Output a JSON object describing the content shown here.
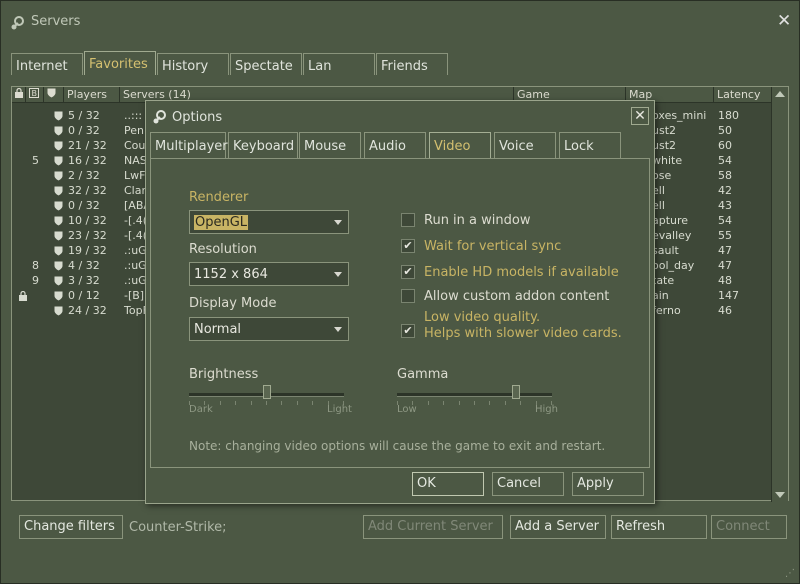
{
  "window": {
    "title": "Servers"
  },
  "tabs": [
    "Internet",
    "Favorites",
    "History",
    "Spectate",
    "Lan",
    "Friends"
  ],
  "active_tab": "Favorites",
  "columns": {
    "players": "Players",
    "servers": "Servers (14)",
    "game": "Game",
    "map": "Map",
    "latency": "Latency"
  },
  "rows": [
    {
      "num": "",
      "players": "5 / 32",
      "name": "..:::",
      "map": "oxes_mini",
      "latency": "180"
    },
    {
      "num": "",
      "players": "0 / 32",
      "name": "Pen:",
      "map": "ust2",
      "latency": "50"
    },
    {
      "num": "",
      "players": "21 / 32",
      "name": "Cou",
      "map": "ust2",
      "latency": "60"
    },
    {
      "num": "5",
      "players": "16 / 32",
      "name": "NAS",
      "map": "white",
      "latency": "54"
    },
    {
      "num": "",
      "players": "2 / 32",
      "name": "LwF",
      "map": "ose",
      "latency": "58"
    },
    {
      "num": "",
      "players": "32 / 32",
      "name": "Clan",
      "map": "ell",
      "latency": "42"
    },
    {
      "num": "",
      "players": "0 / 32",
      "name": "[ABA",
      "map": "ell",
      "latency": "43"
    },
    {
      "num": "",
      "players": "10 / 32",
      "name": "-[.4(",
      "map": "apture",
      "latency": "54"
    },
    {
      "num": "",
      "players": "23 / 32",
      "name": "-[.4(",
      "map": "evalley",
      "latency": "55"
    },
    {
      "num": "",
      "players": "19 / 32",
      "name": ".:uG",
      "map": "sault",
      "latency": "47"
    },
    {
      "num": "8",
      "players": "4 / 32",
      "name": ".:uG",
      "map": "ool_day",
      "latency": "47"
    },
    {
      "num": "9",
      "players": "3 / 32",
      "name": ".:uG",
      "map": "tate",
      "latency": "48"
    },
    {
      "num": "",
      "players": "0 / 12",
      "name": "-[B]:",
      "map": "ain",
      "latency": "147"
    },
    {
      "num": "",
      "players": "24 / 32",
      "name": "TopF",
      "map": "ferno",
      "latency": "46"
    }
  ],
  "bottom": {
    "change_filters": "Change filters",
    "filter_text": "Counter-Strike;",
    "add_current": "Add Current Server",
    "add_server": "Add a Server",
    "refresh": "Refresh",
    "connect": "Connect"
  },
  "dialog": {
    "title": "Options",
    "tabs": [
      "Multiplayer",
      "Keyboard",
      "Mouse",
      "Audio",
      "Video",
      "Voice",
      "Lock"
    ],
    "active_tab": "Video",
    "renderer_label": "Renderer",
    "renderer_value": "OpenGL",
    "resolution_label": "Resolution",
    "resolution_value": "1152 x 864",
    "display_mode_label": "Display Mode",
    "display_mode_value": "Normal",
    "checkboxes": [
      {
        "label": "Run in a window",
        "checked": false
      },
      {
        "label": "Wait for vertical sync",
        "checked": true
      },
      {
        "label": "Enable HD models if available",
        "checked": true
      },
      {
        "label": "Allow custom addon content",
        "checked": false
      },
      {
        "label": "Low video quality.",
        "label2": "Helps with slower video cards.",
        "checked": true
      }
    ],
    "brightness_label": "Brightness",
    "brightness_min": "Dark",
    "brightness_max": "Light",
    "brightness_value": 0.5,
    "gamma_label": "Gamma",
    "gamma_min": "Low",
    "gamma_max": "High",
    "gamma_value": 0.78,
    "note": "Note: changing video options will cause the game to exit and restart.",
    "ok": "OK",
    "cancel": "Cancel",
    "apply": "Apply"
  },
  "colors": {
    "accent": "#c8b464",
    "panel": "#4c5844"
  }
}
